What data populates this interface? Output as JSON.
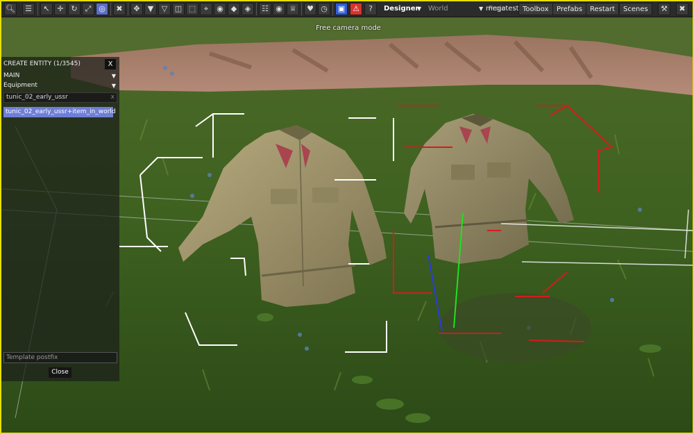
{
  "toolbar": {
    "mode": "Designer",
    "world": "World",
    "user_ghost": "Proje",
    "user": "megatest",
    "menu": [
      "Toolbox",
      "Prefabs",
      "Restart",
      "Scenes"
    ],
    "icons": [
      "search-icon",
      "menu-icon",
      "select-arrow-icon",
      "move-icon",
      "rotate-icon",
      "scale-icon",
      "camera-icon",
      "cut-icon",
      "move-cross-icon",
      "drop-icon",
      "drop-outline-icon",
      "mirror-icon",
      "snap-icon",
      "target-icon",
      "pivot-icon",
      "diamond-icon",
      "axis-icon",
      "document-icon",
      "eye-icon",
      "crown-icon",
      "heart-icon",
      "timer-icon",
      "save-icon",
      "warning-icon",
      "help-icon"
    ],
    "right_icons": [
      "wrench-icon",
      "close-icon"
    ]
  },
  "viewport": {
    "hint": "Free camera mode"
  },
  "panel": {
    "title": "CREATE ENTITY (1/3545)",
    "close_x": "X",
    "category": "MAIN",
    "subcategory": "Equipment",
    "search_value": "tunic_02_early_ussr",
    "search_clear": "x",
    "result": "tunic_02_early_ussr+item_in_world",
    "postfix_placeholder": "Template postfix",
    "close_label": "Close"
  },
  "colors": {
    "toolbar_bg": "#2b2b2b",
    "active_blue": "#5a6ec8",
    "selection": "#6f7fd8",
    "frame": "#e6e000",
    "warning": "#d8342c"
  }
}
